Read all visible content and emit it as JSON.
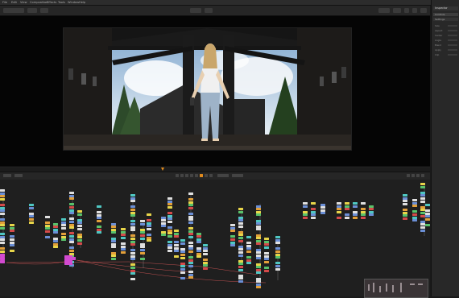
{
  "app": {
    "menu": [
      "File",
      "Edit",
      "View",
      "Composition",
      "Effects",
      "Tools",
      "Window",
      "Help"
    ]
  },
  "viewer": {
    "image_description_icon": "viewer-image"
  },
  "inspector": {
    "title": "Inspector",
    "properties": [
      "Controls",
      "Settings",
      "Size",
      "Aspect",
      "Center",
      "Angle",
      "Blend",
      "Apply",
      "Clip"
    ]
  },
  "node_graph": {
    "node_colors": {
      "loader": "#e0e0e0",
      "blue": "#6b8fd6",
      "orange": "#e3a03a",
      "yellow": "#e8d54a",
      "green": "#59c26b",
      "red": "#d44a4a",
      "pink": "#d24ad0",
      "teal": "#4fc7c2"
    }
  },
  "colors": {
    "accent": "#e08a1e",
    "background": "#1f1f1f",
    "panel": "#282828"
  }
}
